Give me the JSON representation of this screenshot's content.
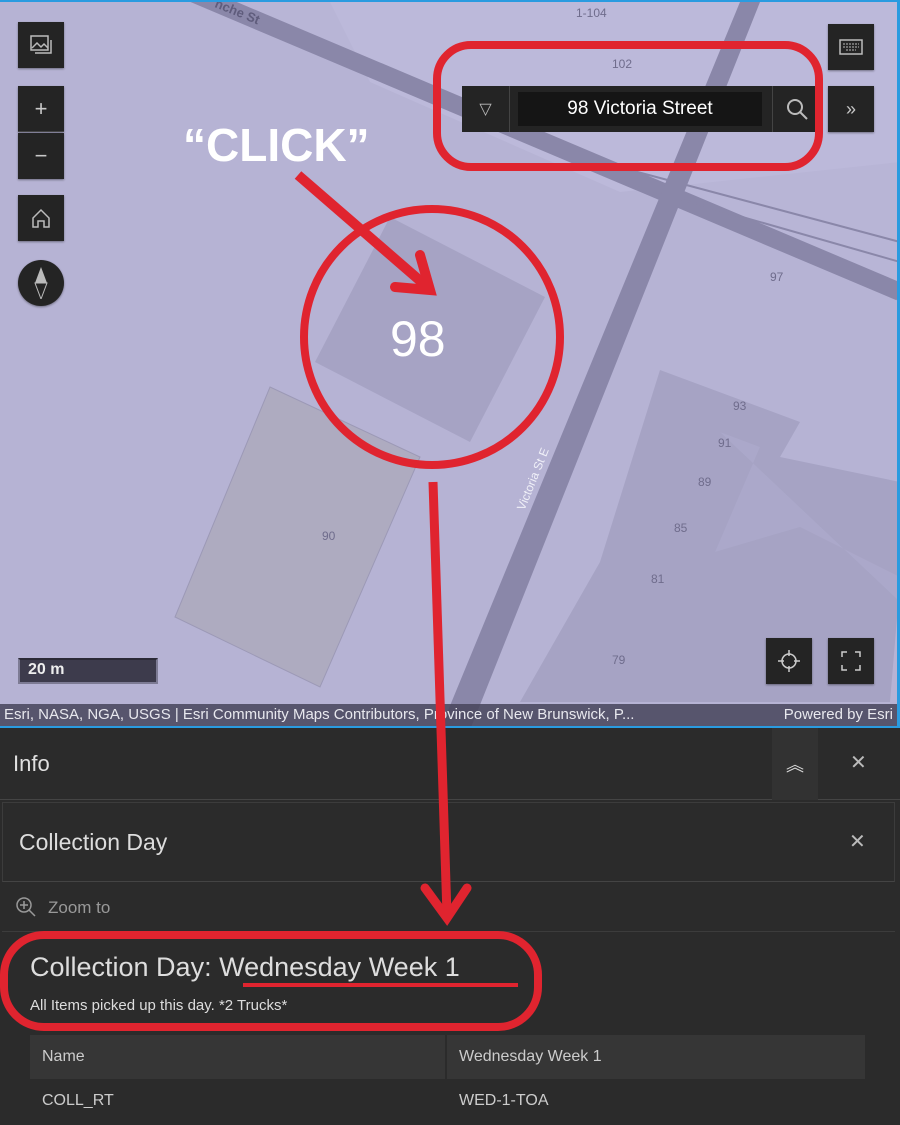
{
  "map": {
    "street_labels": [
      "nche St",
      "Victoria St E"
    ],
    "address_labels": [
      "1-104",
      "102",
      "97",
      "93",
      "91",
      "89",
      "85",
      "81",
      "79",
      "90"
    ],
    "highlighted_parcel": "98",
    "scale_label": "20 m",
    "attribution": "Esri, NASA, NGA, USGS | Esri Community Maps Contributors, Province of New Brunswick, P...",
    "powered_by": "Powered by Esri",
    "search": {
      "value": "98 Victoria Street"
    },
    "controls": [
      "basemap-icon",
      "zoom-in-icon",
      "zoom-out-icon",
      "home-icon",
      "compass-icon",
      "keyboard-icon",
      "expand-icon",
      "locate-icon",
      "fullscreen-icon"
    ]
  },
  "annotations": {
    "click_label": "“CLICK”",
    "color": "#e0242f"
  },
  "panel": {
    "title": "Info",
    "card_title": "Collection Day",
    "zoom_to": "Zoom to",
    "heading_prefix": "Collection Day: ",
    "heading_value": "Wednesday Week 1",
    "description": "All Items picked up this day. *2 Trucks*",
    "table": {
      "headers": [
        "Name",
        "Wednesday Week 1"
      ],
      "rows": [
        [
          "COLL_RT",
          "WED-1-TOA"
        ]
      ]
    }
  }
}
